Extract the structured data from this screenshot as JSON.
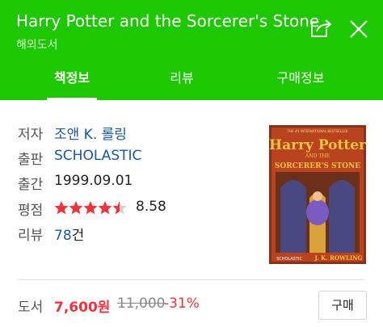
{
  "header": {
    "title": "Harry Potter and the Sorcerer's Stone",
    "subtitle": "해외도서"
  },
  "tabs": [
    {
      "label": "책정보",
      "active": true
    },
    {
      "label": "리뷰",
      "active": false
    },
    {
      "label": "구매정보",
      "active": false
    }
  ],
  "info": {
    "author_label": "저자",
    "author": "조앤 K. 롤링",
    "publisher_label": "출판",
    "publisher": "SCHOLASTIC",
    "date_label": "출간",
    "date": "1999.09.01",
    "rating_label": "평점",
    "rating": "8.58",
    "rating_stars_out_of_5": 4.5,
    "review_label": "리뷰",
    "review_count": "78",
    "review_unit": "건"
  },
  "cover": {
    "top_text": "THE #1 INTERNATIONAL BESTSELLER",
    "title_line1": "Harry Potter",
    "title_line2": "AND THE",
    "title_line3": "SORCERER'S STONE",
    "publisher": "SCHOLASTIC",
    "author": "J. K. ROWLING"
  },
  "price": {
    "label": "도서",
    "sale": "7,600원",
    "original": "11,000",
    "discount": "-31%",
    "buy_label": "구매"
  },
  "colors": {
    "brand_green": "#1ec800",
    "price_red": "#f0323c",
    "link_blue": "#1a57a8"
  }
}
